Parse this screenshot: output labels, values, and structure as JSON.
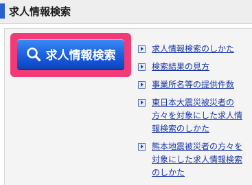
{
  "header": {
    "title": "求人情報検索"
  },
  "search_button": {
    "label": "求人情報検索",
    "icon": "search-icon"
  },
  "colors": {
    "accent": "#2a5fd0",
    "highlight": "#f23a77",
    "button": "#1a5fe0",
    "link": "#1a36a6"
  },
  "links": [
    {
      "label": "求人情報検索のしかた",
      "icon": "bullet-arrow-icon"
    },
    {
      "label": "検索結果の見方",
      "icon": "bullet-arrow-icon"
    },
    {
      "label": "事業所名等の提供件数",
      "icon": "bullet-arrow-icon"
    },
    {
      "label": "東日本大震災被災者の方々を対象にした求人情報検索のしかた",
      "icon": "bullet-arrow-icon"
    },
    {
      "label": "熊本地震被災者の方々を対象にした求人情報検索のしかた",
      "icon": "bullet-arrow-icon"
    }
  ]
}
